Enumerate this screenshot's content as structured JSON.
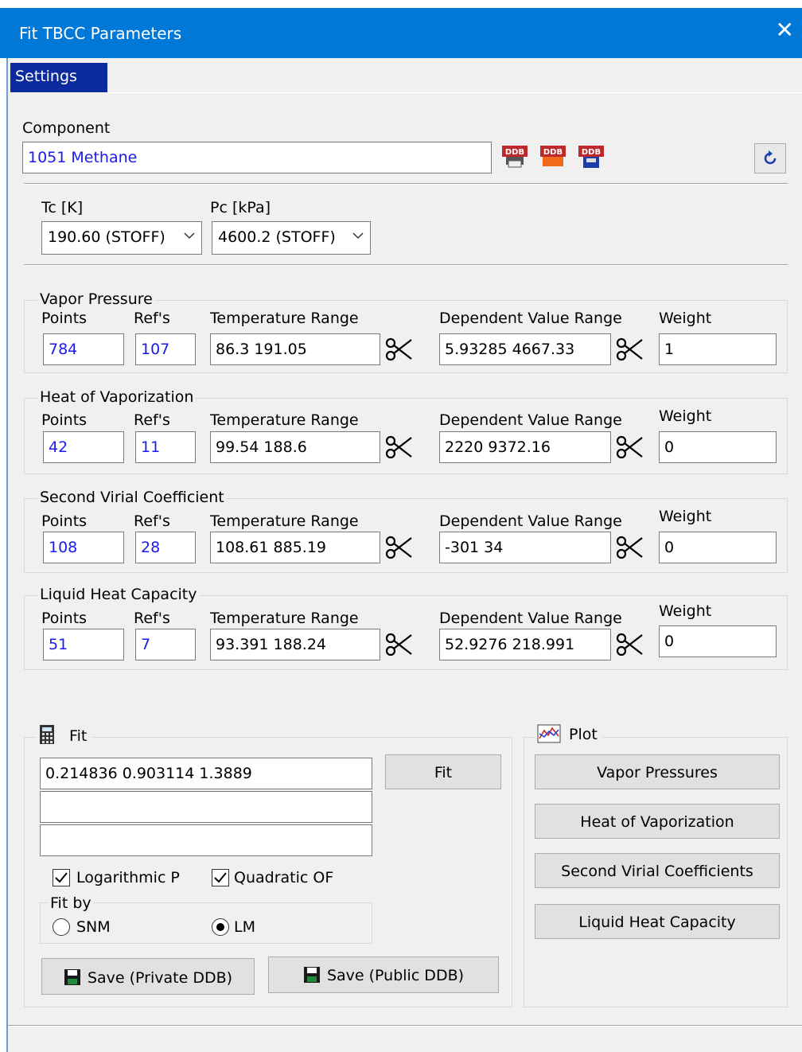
{
  "window": {
    "title": "Fit TBCC Parameters",
    "close_glyph": "✕"
  },
  "tab": {
    "label": "Settings"
  },
  "component": {
    "label": "Component",
    "value": "1051 Methane",
    "icons": [
      "ddb-print-icon",
      "ddb-orange-icon",
      "ddb-save-icon"
    ]
  },
  "critical": {
    "tc_label": "Tc [K]",
    "tc_value": "190.60 (STOFF)",
    "pc_label": "Pc [kPa]",
    "pc_value": "4600.2 (STOFF)"
  },
  "headers": {
    "points": "Points",
    "refs": "Ref's",
    "temp_range": "Temperature Range",
    "dep_range": "Dependent Value Range",
    "weight": "Weight"
  },
  "groups": [
    {
      "title": "Vapor Pressure",
      "points": "784",
      "refs": "107",
      "temp_range": "86.3 191.05",
      "dep_range": "5.93285 4667.33",
      "weight": "1"
    },
    {
      "title": "Heat of Vaporization",
      "points": "42",
      "refs": "11",
      "temp_range": "99.54 188.6",
      "dep_range": "2220 9372.16",
      "weight": "0"
    },
    {
      "title": "Second Virial Coefficient",
      "points": "108",
      "refs": "28",
      "temp_range": "108.61 885.19",
      "dep_range": "-301 34",
      "weight": "0"
    },
    {
      "title": "Liquid Heat Capacity",
      "points": "51",
      "refs": "7",
      "temp_range": "93.391 188.24",
      "dep_range": "52.9276 218.991",
      "weight": "0"
    }
  ],
  "fit": {
    "title": "Fit",
    "result1": "0.214836     0.903114     1.3889",
    "result2": "",
    "result3": "",
    "fit_button": "Fit",
    "log_p_label": "Logarithmic P",
    "log_p_checked": true,
    "quad_of_label": "Quadratic OF",
    "quad_of_checked": true,
    "fitby_title": "Fit by",
    "snm_label": "SNM",
    "lm_label": "LM",
    "selected": "LM",
    "save_private": "Save (Private DDB)",
    "save_public": "Save (Public DDB)"
  },
  "plot": {
    "title": "Plot",
    "buttons": [
      "Vapor Pressures",
      "Heat of Vaporization",
      "Second Virial Coefficients",
      "Liquid Heat Capacity"
    ]
  },
  "colors": {
    "title_bar": "#0078d7",
    "tab_active": "#0a2a9e",
    "value_text": "#1a1aee",
    "background": "#f0f0f0"
  }
}
